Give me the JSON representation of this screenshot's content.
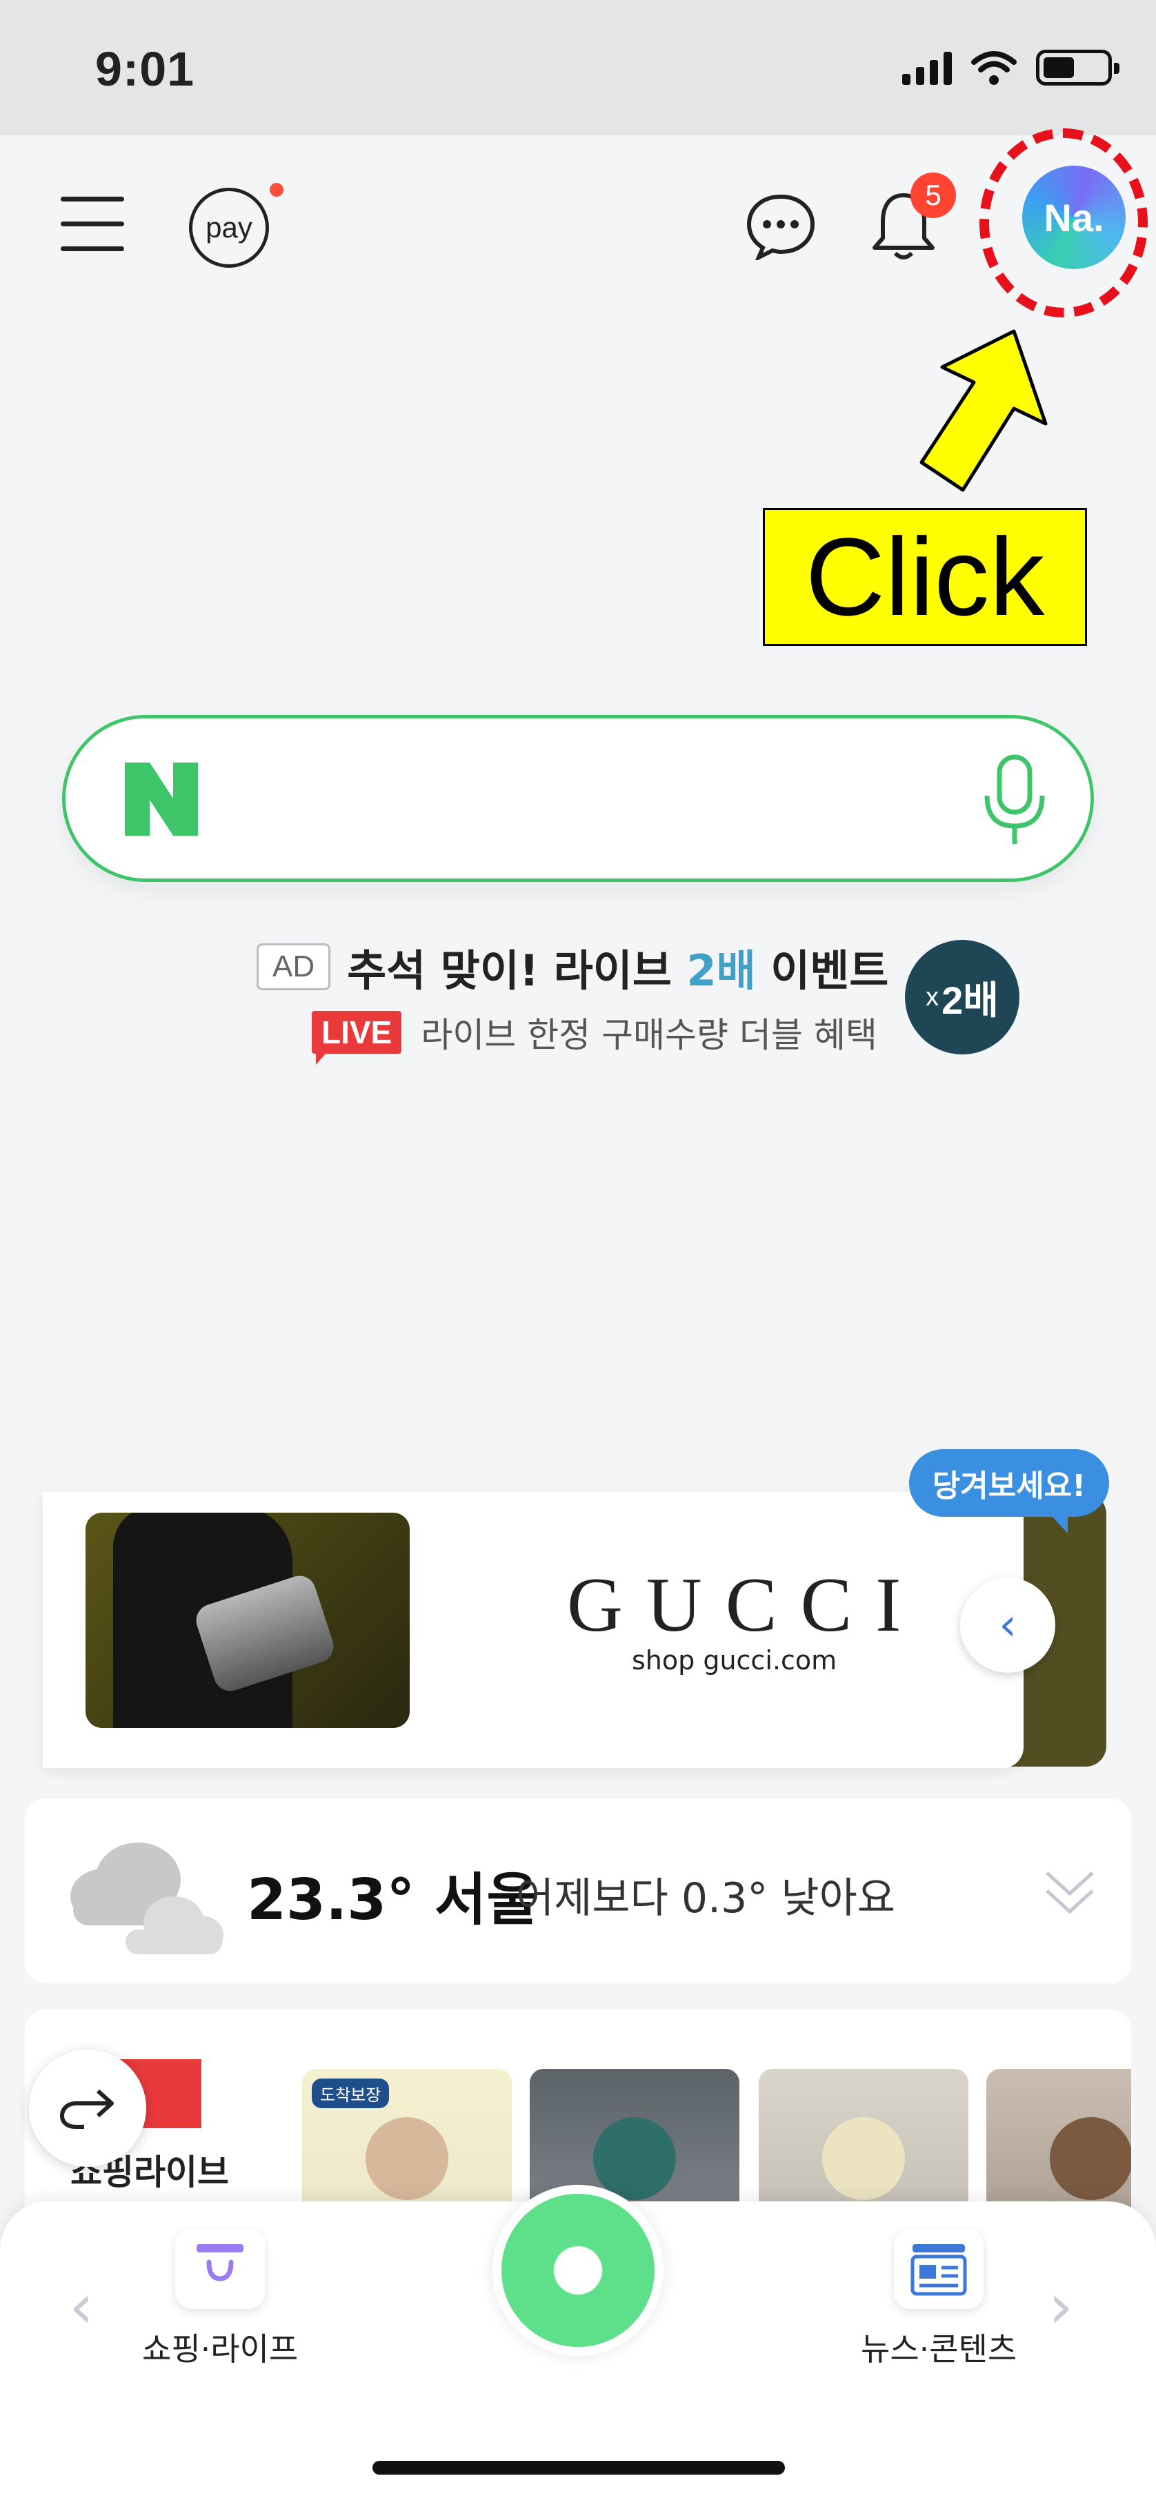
{
  "status_bar": {
    "time": "9:01"
  },
  "header": {
    "pay_label": "pay",
    "notification_count": "5",
    "avatar_text": "Na."
  },
  "annotation": {
    "click_label": "Click"
  },
  "search": {
    "placeholder": ""
  },
  "ad": {
    "tag": "AD",
    "title_part1": "추석 맞이! 라이브 ",
    "title_highlight": "2배",
    "title_part2": " 이벤트",
    "live_tag": "LIVE",
    "subtitle": "라이브 한정 구매수량 더블 혜택",
    "badge_small": "x",
    "badge_big": "2배"
  },
  "banner": {
    "brand": "GUCCI",
    "url": "shop gucci.com",
    "pull_bubble": "당겨보세요!"
  },
  "weather": {
    "temperature": "23.3°",
    "city": "서울",
    "comparison": "어제보다 0.3° 낮아요"
  },
  "shopping_live": {
    "label": "쇼핑라이브",
    "thumb1_tag": "도착보장"
  },
  "bottom_nav": {
    "left_label": "쇼핑·라이프",
    "right_label": "뉴스·콘텐츠"
  },
  "colors": {
    "naver_green": "#3ec56a",
    "alert_red": "#e8101a",
    "annotation_yellow": "#ffff00"
  }
}
